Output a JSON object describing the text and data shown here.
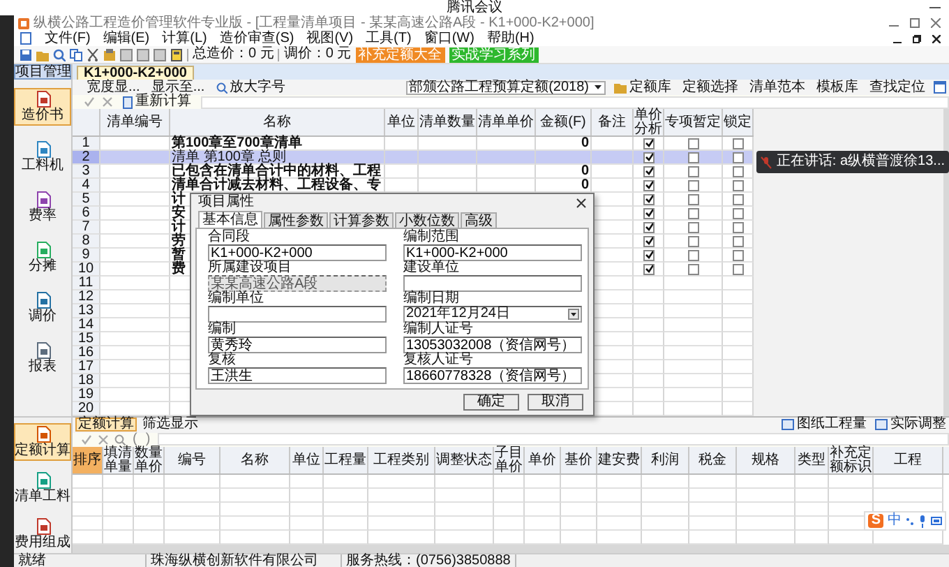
{
  "meeting_bar": {
    "title": "腾讯会议"
  },
  "window": {
    "title": "纵横公路工程造价管理软件专业版 - [工程量清单项目 - 某某高速公路A段 - K1+000-K2+000]"
  },
  "menu": [
    "文件(F)",
    "编辑(E)",
    "计算(L)",
    "造价审查(S)",
    "视图(V)",
    "工具(T)",
    "窗口(W)",
    "帮助(H)"
  ],
  "toolbar": {
    "total": "总造价：0 元",
    "adjust": "调价：0 元",
    "buttons": [
      {
        "label": "补充定额大全",
        "color": "#f08a24"
      },
      {
        "label": "实战学习系列",
        "color": "#2eb82e"
      }
    ]
  },
  "project_tab": {
    "label": "项目管理",
    "selected": true
  },
  "doc_tabs": [
    {
      "label": "K1+000-K2+000",
      "selected": true
    }
  ],
  "view_toolbar": {
    "left": [
      "宽度显...",
      "显示至..."
    ],
    "zoom": "放大字号",
    "quota_select": "部颁公路工程预算定额(2018)",
    "right": [
      "定额库",
      "定额选择",
      "清单范本",
      "模板库",
      "查找定位"
    ]
  },
  "calc_toolbar": {
    "recalc": "重新计算"
  },
  "nav_top": [
    {
      "label": "造价书",
      "selected": true
    },
    {
      "label": "工料机",
      "selected": false
    },
    {
      "label": "费率",
      "selected": false
    },
    {
      "label": "分摊",
      "selected": false
    },
    {
      "label": "调价",
      "selected": false
    },
    {
      "label": "报表",
      "selected": false
    }
  ],
  "nav_bottom": [
    {
      "label": "定额计算",
      "selected": true
    },
    {
      "label": "清单工料",
      "selected": false
    },
    {
      "label": "费用组成",
      "selected": false
    }
  ],
  "bill_table": {
    "columns": [
      "",
      "清单编号",
      "名称",
      "单位",
      "清单数量",
      "清单单价",
      "金额(F)",
      "备注",
      "单价分析",
      "专项暂定",
      "锁定"
    ],
    "rows": [
      {
        "no": "1",
        "name": "第100章至700章清单",
        "bold": true,
        "amount": "0",
        "analysis": true,
        "special": false,
        "locked": false,
        "selected": false
      },
      {
        "no": "2",
        "name": "清单 第100章 总则",
        "bold": false,
        "analysis": true,
        "special": false,
        "locked": false,
        "selected": true
      },
      {
        "no": "3",
        "name": "已包含在清单合计中的材料、工程",
        "bold": true,
        "amount": "0",
        "analysis": true,
        "special": false,
        "locked": false,
        "selected": false
      },
      {
        "no": "4",
        "name": "清单合计减去材料、工程设备、专",
        "bold": true,
        "amount": "0",
        "analysis": true,
        "special": false,
        "locked": false,
        "selected": false
      },
      {
        "no": "5",
        "name": "计",
        "bold": true,
        "analysis": true,
        "special": false,
        "locked": false,
        "selected": false
      },
      {
        "no": "6",
        "name": "安",
        "bold": true,
        "analysis": true,
        "special": false,
        "locked": false,
        "selected": false
      },
      {
        "no": "7",
        "name": "计",
        "bold": true,
        "analysis": true,
        "special": false,
        "locked": false,
        "selected": false
      },
      {
        "no": "8",
        "name": "劳",
        "bold": true,
        "analysis": true,
        "special": false,
        "locked": false,
        "selected": false
      },
      {
        "no": "9",
        "name": "暂",
        "bold": true,
        "analysis": true,
        "special": false,
        "locked": false,
        "selected": false
      },
      {
        "no": "10",
        "name": "费",
        "bold": true,
        "analysis": true,
        "special": false,
        "locked": false,
        "selected": false
      },
      {
        "no": "11",
        "selected": false
      },
      {
        "no": "12",
        "selected": false
      },
      {
        "no": "13",
        "selected": false
      },
      {
        "no": "14",
        "selected": false
      },
      {
        "no": "15",
        "selected": false
      },
      {
        "no": "16",
        "selected": false
      },
      {
        "no": "17",
        "selected": false
      },
      {
        "no": "18",
        "selected": false
      },
      {
        "no": "19",
        "selected": false
      },
      {
        "no": "20",
        "selected": false
      }
    ]
  },
  "toast": {
    "text": "正在讲话: a纵横普渡徐13..."
  },
  "dialog": {
    "title": "项目属性",
    "tabs": [
      {
        "label": "基本信息",
        "selected": true
      },
      {
        "label": "属性参数",
        "selected": false
      },
      {
        "label": "计算参数",
        "selected": false
      },
      {
        "label": "小数位数",
        "selected": false
      },
      {
        "label": "高级",
        "selected": false
      }
    ],
    "fields": [
      {
        "label": "合同段",
        "value": "K1+000-K2+000",
        "kind": "text",
        "disabled": false
      },
      {
        "label": "编制范围",
        "value": "K1+000-K2+000",
        "kind": "text",
        "disabled": false
      },
      {
        "label": "所属建设项目",
        "value": "某某高速公路A段",
        "kind": "text",
        "disabled": true
      },
      {
        "label": "建设单位",
        "kind": "text",
        "disabled": false
      },
      {
        "label": "编制单位",
        "kind": "text",
        "disabled": false
      },
      {
        "label": "编制日期",
        "value": "2021年12月24日",
        "kind": "date",
        "disabled": false
      },
      {
        "label": "编制",
        "value": "黄秀玲",
        "kind": "text",
        "disabled": false
      },
      {
        "label": "编制人证号",
        "value": "13053032008（资信网号）",
        "kind": "text",
        "disabled": false
      },
      {
        "label": "复核",
        "value": "王洪生",
        "kind": "text",
        "disabled": false
      },
      {
        "label": "复核人证号",
        "value": "18660778328（资信网号）",
        "kind": "text",
        "disabled": false
      }
    ],
    "buttons": [
      "确定",
      "取消"
    ]
  },
  "quota_tabs": [
    {
      "label": "定额计算",
      "selected": true
    },
    {
      "label": "筛选显示",
      "selected": false
    }
  ],
  "quota_tools": [
    "图纸工程量",
    "实际调整"
  ],
  "formula_buttons": [
    "(",
    ")"
  ],
  "quota_table": {
    "columns": [
      "排序",
      "填清单量",
      "数量单价",
      "编号",
      "名称",
      "单位",
      "工程量",
      "工程类别",
      "调整状态",
      "子目单价",
      "单价",
      "基价",
      "建安费",
      "利润",
      "税金",
      "规格",
      "类型",
      "补充定额标识",
      "工程"
    ]
  },
  "ime": {
    "logo": "S",
    "mode": "中"
  },
  "status_bar": [
    "就绪",
    "珠海纵横创新软件有限公司",
    "服务热线：(0756)3850888"
  ]
}
